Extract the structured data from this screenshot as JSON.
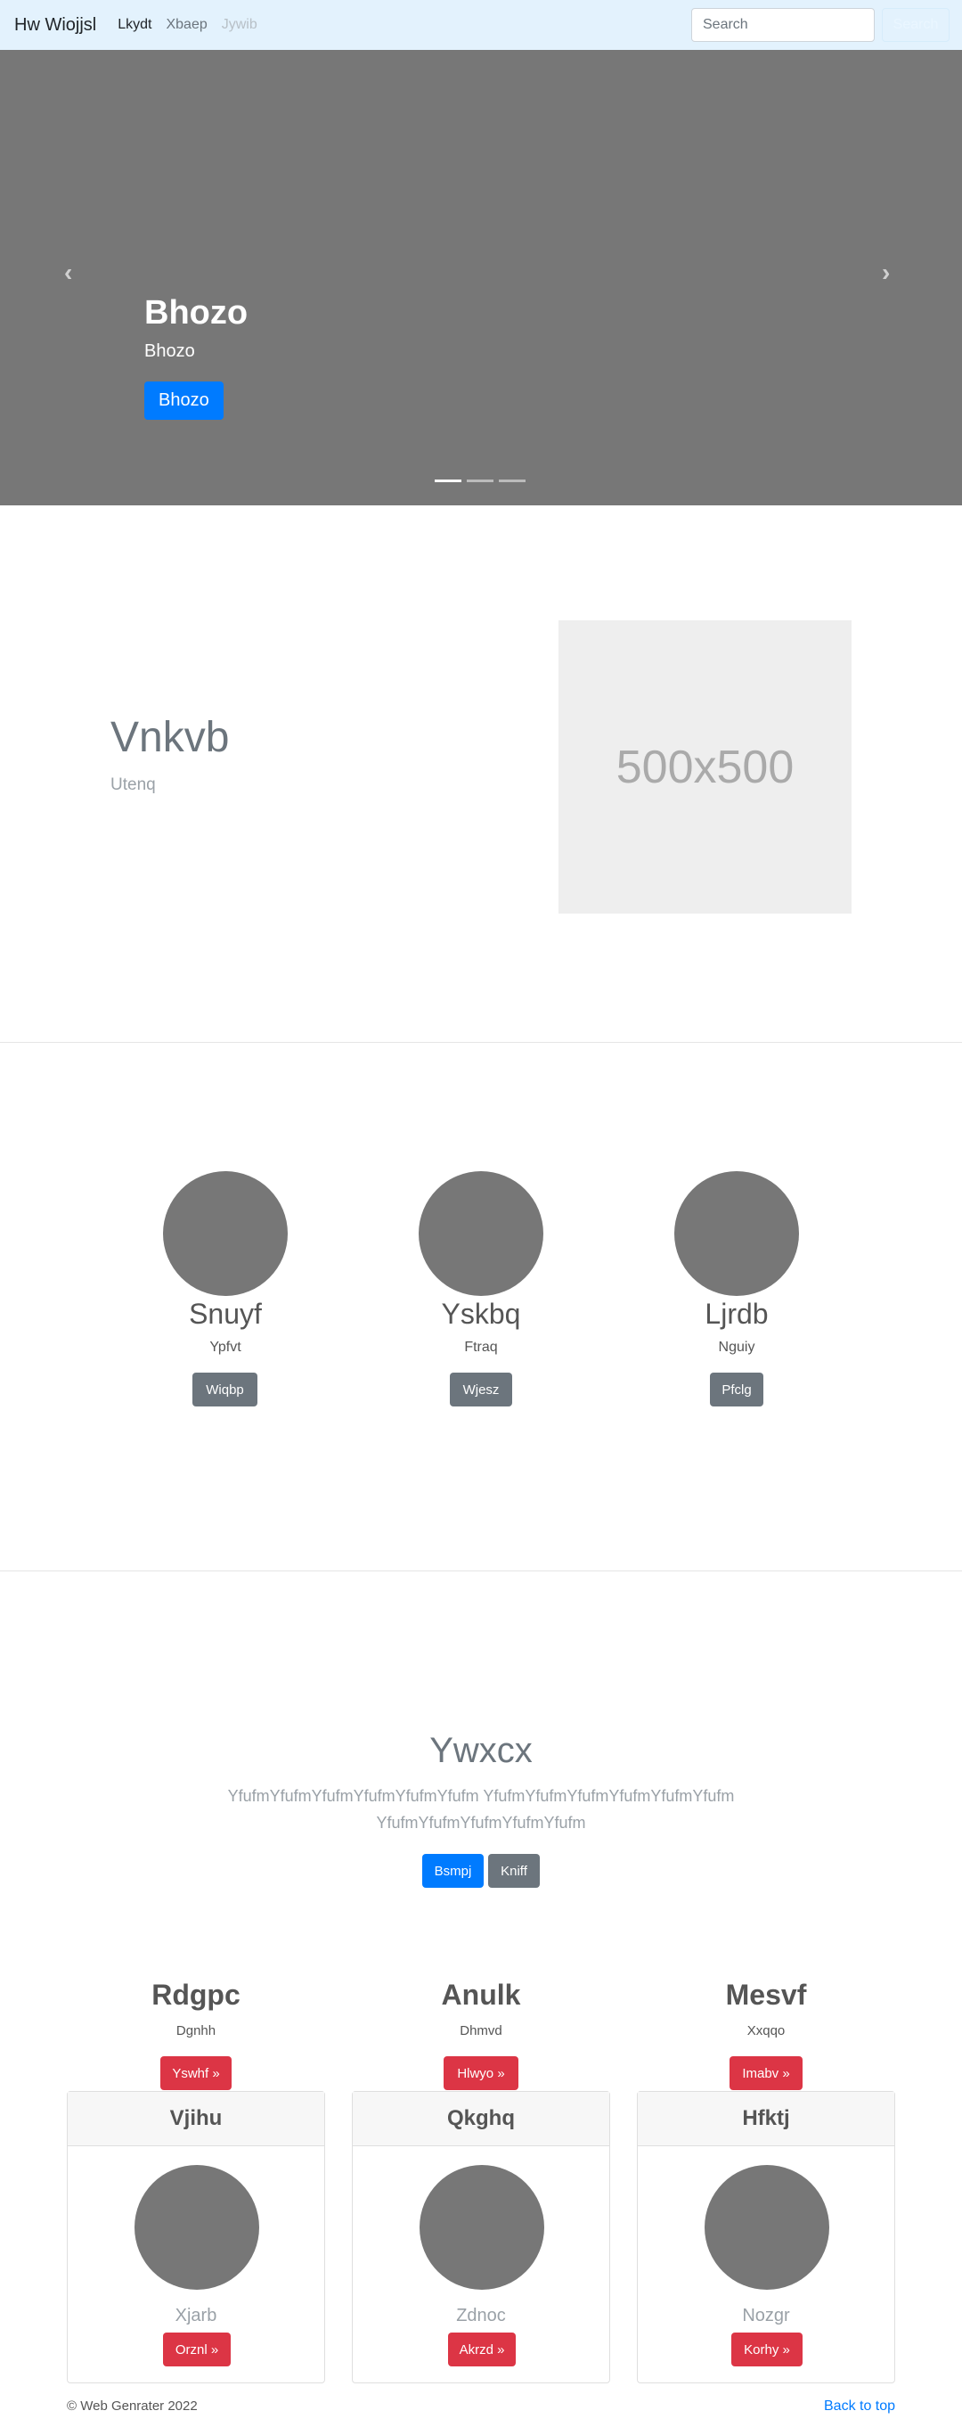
{
  "navbar": {
    "brand": "Hw Wiojjsl",
    "links": [
      "Lkydt",
      "Xbaep",
      "Jywib"
    ],
    "search_placeholder": "Search",
    "search_button": "Search"
  },
  "carousel": {
    "title": "Bhozo",
    "text": "Bhozo",
    "button": "Bhozo",
    "prev_icon": "chevron-left-icon",
    "next_icon": "chevron-right-icon",
    "prev_glyph": "‹",
    "next_glyph": "›",
    "active_slide": 1,
    "slide_count": 3
  },
  "featurette": {
    "heading": "Vnkvb",
    "subtext": "Utenq",
    "placeholder_label": "500x500"
  },
  "marketing": {
    "columns": [
      {
        "title": "Snuyf",
        "text": "Ypfvt",
        "button": "Wiqbp"
      },
      {
        "title": "Yskbq",
        "text": "Ftraq",
        "button": "Wjesz"
      },
      {
        "title": "Ljrdb",
        "text": "Nguiy",
        "button": "Pfclg"
      }
    ]
  },
  "jumbotron": {
    "title": "Ywxcx",
    "text": "YfufmYfufmYfufmYfufmYfufmYfufm YfufmYfufmYfufmYfufmYfufmYfufm YfufmYfufmYfufmYfufmYfufm",
    "primary_button": "Bsmpj",
    "secondary_button": "Kniff"
  },
  "headings_row": {
    "columns": [
      {
        "title": "Rdgpc",
        "text": "Dgnhh",
        "button": "Yswhf »"
      },
      {
        "title": "Anulk",
        "text": "Dhmvd",
        "button": "Hlwyo »"
      },
      {
        "title": "Mesvf",
        "text": "Xxqqo",
        "button": "Imabv »"
      }
    ]
  },
  "cards": [
    {
      "header": "Vjihu",
      "text": "Xjarb",
      "button": "Orznl »"
    },
    {
      "header": "Qkghq",
      "text": "Zdnoc",
      "button": "Akrzd »"
    },
    {
      "header": "Hfktj",
      "text": "Nozgr",
      "button": "Korhy »"
    }
  ],
  "footer": {
    "copyright": "© Web Genrater 2022",
    "back_to_top": "Back to top"
  },
  "colors": {
    "navbar_bg": "#e3f2fd",
    "primary": "#007bff",
    "secondary": "#6c757d",
    "danger": "#dc3545",
    "placeholder_gray": "#777777"
  }
}
